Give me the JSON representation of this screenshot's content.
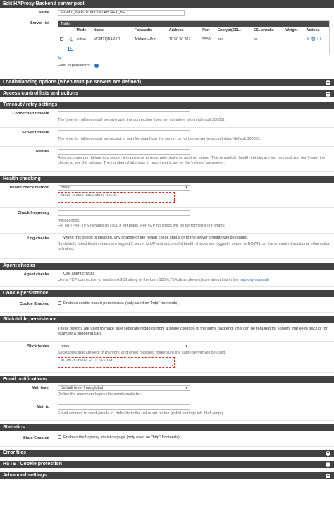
{
  "panel_title": "Edit HAProxy Backend server pool",
  "name": {
    "label": "Name",
    "value": "MGMTQNAP-01.MYVMLAB.NET_BE"
  },
  "server_list": {
    "label": "Server list",
    "table_caption": "Table",
    "columns": [
      "Mode",
      "Name",
      "Forwardto",
      "Address",
      "Port",
      "Encrypt(SSL)",
      "SSL checks",
      "Weight",
      "Actions"
    ],
    "rows": [
      {
        "mode": "active",
        "name": "MGMTQNAP-01",
        "forwardto": "Address+Port",
        "address": "10.50.50.202",
        "port": "5553",
        "encrypt": "yes",
        "ssl_checks": "no",
        "weight": ""
      }
    ],
    "add_icon": "plus-square-icon",
    "field_explanations": "Field explanations:"
  },
  "sections": {
    "loadbalancing": "Loadbalancing options (when multiple servers are defined)",
    "acl": "Access control lists and actions",
    "timeout": "Timeout / retry settings",
    "health": "Health checking",
    "agent": "Agent checks",
    "cookie": "Cookie persistence",
    "stick": "Stick-table persistence",
    "email": "Email notifications",
    "stats": "Statistics",
    "errors": "Error files",
    "hsts": "HSTS / Cookie protection",
    "advanced": "Advanced settings"
  },
  "timeout": {
    "connection_label": "Connection timeout",
    "connection_desc": "The time (in milliseconds) we give up if the connection does not complete within (default 30000).",
    "server_label": "Server timeout",
    "server_desc": "The time (in milliseconds) we accept to wait for data from the server, or for the server to accept data (default 30000).",
    "retries_label": "Retries",
    "retries_desc": "After a connection failure to a server, it is possible to retry, potentially on another server. This is useful if health-checks are too rare and you don't want the clients to see the failures. The number of attempts to reconnect is set by the \"retries\" parameter."
  },
  "health": {
    "method_label": "Health check method",
    "method_value": "Basic",
    "method_box": "Basic socket connection check",
    "freq_label": "Check frequency",
    "freq_unit": "milliseconds",
    "freq_desc": "For HTTP/HTTPS defaults to 1000 if left blank. For TCP no check will be performed if left empty.",
    "log_label": "Log checks",
    "log_text": "When this option is enabled, any change of the health check status or to the server's health will be logged.",
    "log_desc": "By default, failed health check are logged if server is UP and successful health checks are logged if server is DOWN, so the amount of additional information is limited."
  },
  "agent": {
    "label": "Agent checks",
    "text": "Use agent checks",
    "desc_pre": "Use a TCP connection to read an ASCII string of the form 100%,75%,drain,down (more about this in the ",
    "desc_link": "haproxy manual",
    "desc_post": ")"
  },
  "cookie": {
    "label": "Cookie Enabled",
    "text": "Enables cookie based persistence. (only used on \"http\" frontends)"
  },
  "stick": {
    "intro": "These options are used to make sure seperate requests from a single client go to the same backend. This can be required for servers that keep track of for example a shopping cart.",
    "label": "Stick tables",
    "value": "none",
    "desc": "Sticktables that are kept in memory, and when matched make sure the same server will be used.",
    "box": "No stick-table will be used"
  },
  "email": {
    "level_label": "Mail level",
    "level_value": "Default level from global",
    "level_desc": "Define the maximum loglevel to send emails for.",
    "to_label": "Mail to",
    "to_desc": "Email address to send emails to, defaults to the value set on the global settings tab if left empty."
  },
  "stats": {
    "label": "Stats Enabled",
    "text": "Enables the haproxy statistics page (only used on \"http\" frontends)"
  }
}
